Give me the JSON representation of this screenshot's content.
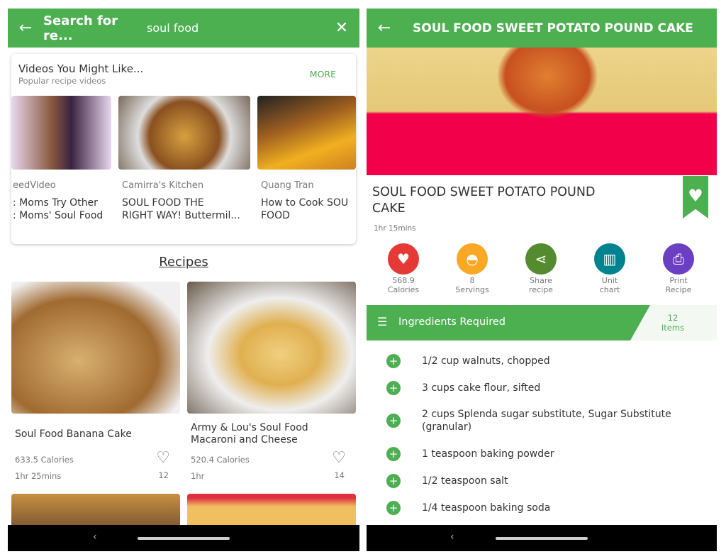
{
  "colors": {
    "accent": "#4caf50"
  },
  "search": {
    "title": "Search for re...",
    "query": "soul food",
    "back_icon": "arrow-left",
    "clear_icon": "close"
  },
  "videos": {
    "title": "Videos You Might Like...",
    "subtitle": "Popular recipe videos",
    "more": "MORE",
    "items": [
      {
        "source": "eedVideo",
        "title": ": Moms Try Other\n: Moms' Soul Food"
      },
      {
        "source": "Camirra's Kitchen",
        "title": "SOUL FOOD THE\nRIGHT WAY! Buttermil..."
      },
      {
        "source": "Quang Tran",
        "title": "How to Cook SOU\nFOOD"
      }
    ]
  },
  "recipes_heading": "Recipes",
  "recipes": [
    {
      "name": "Soul Food Banana Cake",
      "calories": "633.5 Calories",
      "time": "1hr 25mins",
      "likes": "12"
    },
    {
      "name": "Army & Lou's Soul Food Macaroni and Cheese",
      "calories": "520.4 Calories",
      "time": "1hr",
      "likes": "14"
    }
  ],
  "detail": {
    "header": "SOUL FOOD SWEET POTATO  POUND CAKE",
    "title": "SOUL FOOD SWEET POTATO  POUND CAKE",
    "time": "1hr 15mins",
    "actions": [
      {
        "top": "568.9",
        "bottom": "Calories",
        "color": "#e53935",
        "icon": "calorie-flame"
      },
      {
        "top": "8",
        "bottom": "Servings",
        "color": "#f9a825",
        "icon": "serving-cloche"
      },
      {
        "top": "Share",
        "bottom": "recipe",
        "color": "#558b2f",
        "icon": "share"
      },
      {
        "top": "Unit",
        "bottom": "chart",
        "color": "#00838f",
        "icon": "ruler"
      },
      {
        "top": "Print",
        "bottom": "Recipe",
        "color": "#6a3fc1",
        "icon": "printer"
      }
    ],
    "ingredients_label": "Ingredients Required",
    "items_count": "12",
    "items_label": "Items",
    "ingredients": [
      "1/2 cup walnuts, chopped",
      "3 cups cake flour, sifted",
      "2 cups Splenda sugar substitute, Sugar Substitute (granular)",
      "1 teaspoon baking powder",
      "1/2 teaspoon salt",
      "1/4 teaspoon baking soda"
    ]
  }
}
